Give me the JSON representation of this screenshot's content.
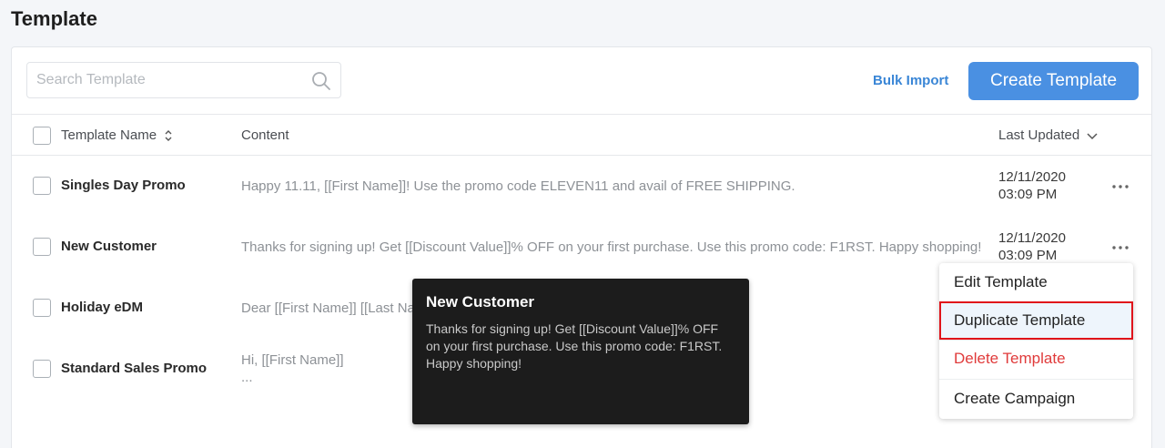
{
  "page": {
    "title": "Template"
  },
  "search": {
    "placeholder": "Search Template",
    "value": ""
  },
  "toolbar": {
    "bulk_import_label": "Bulk Import",
    "create_label": "Create Template"
  },
  "table": {
    "columns": {
      "name": "Template Name",
      "content": "Content",
      "updated": "Last Updated"
    },
    "rows": [
      {
        "name": "Singles Day Promo",
        "content": "Happy 11.11, [[First Name]]! Use the promo code ELEVEN11 and avail of FREE SHIPPING.",
        "date": "12/11/2020",
        "time": "03:09 PM"
      },
      {
        "name": "New Customer",
        "content": "Thanks for signing up! Get [[Discount Value]]% OFF on your first purchase. Use this promo code: F1RST. Happy shopping!",
        "date": "12/11/2020",
        "time": "03:09 PM"
      },
      {
        "name": "Holiday eDM",
        "content": "Dear [[First Name]] [[Last Name]]"
      },
      {
        "name": "Standard Sales Promo",
        "content_line1": "Hi, [[First Name]]",
        "content_line2": "..."
      }
    ]
  },
  "tooltip": {
    "title": "New Customer",
    "body": "Thanks for signing up! Get [[Discount Value]]% OFF on your first purchase. Use this promo code: F1RST. Happy shopping!"
  },
  "menu": {
    "items": [
      {
        "label": "Edit Template"
      },
      {
        "label": "Duplicate Template"
      },
      {
        "label": "Delete Template"
      },
      {
        "label": "Create Campaign"
      }
    ]
  },
  "colors": {
    "accent": "#4a90e2",
    "link": "#3a86d6",
    "danger": "#e03b3b",
    "highlight_border": "#e0141a",
    "tooltip_bg": "#1c1c1c"
  },
  "icons": [
    "search-icon",
    "sort-icon",
    "chevron-down-icon",
    "more-icon"
  ]
}
